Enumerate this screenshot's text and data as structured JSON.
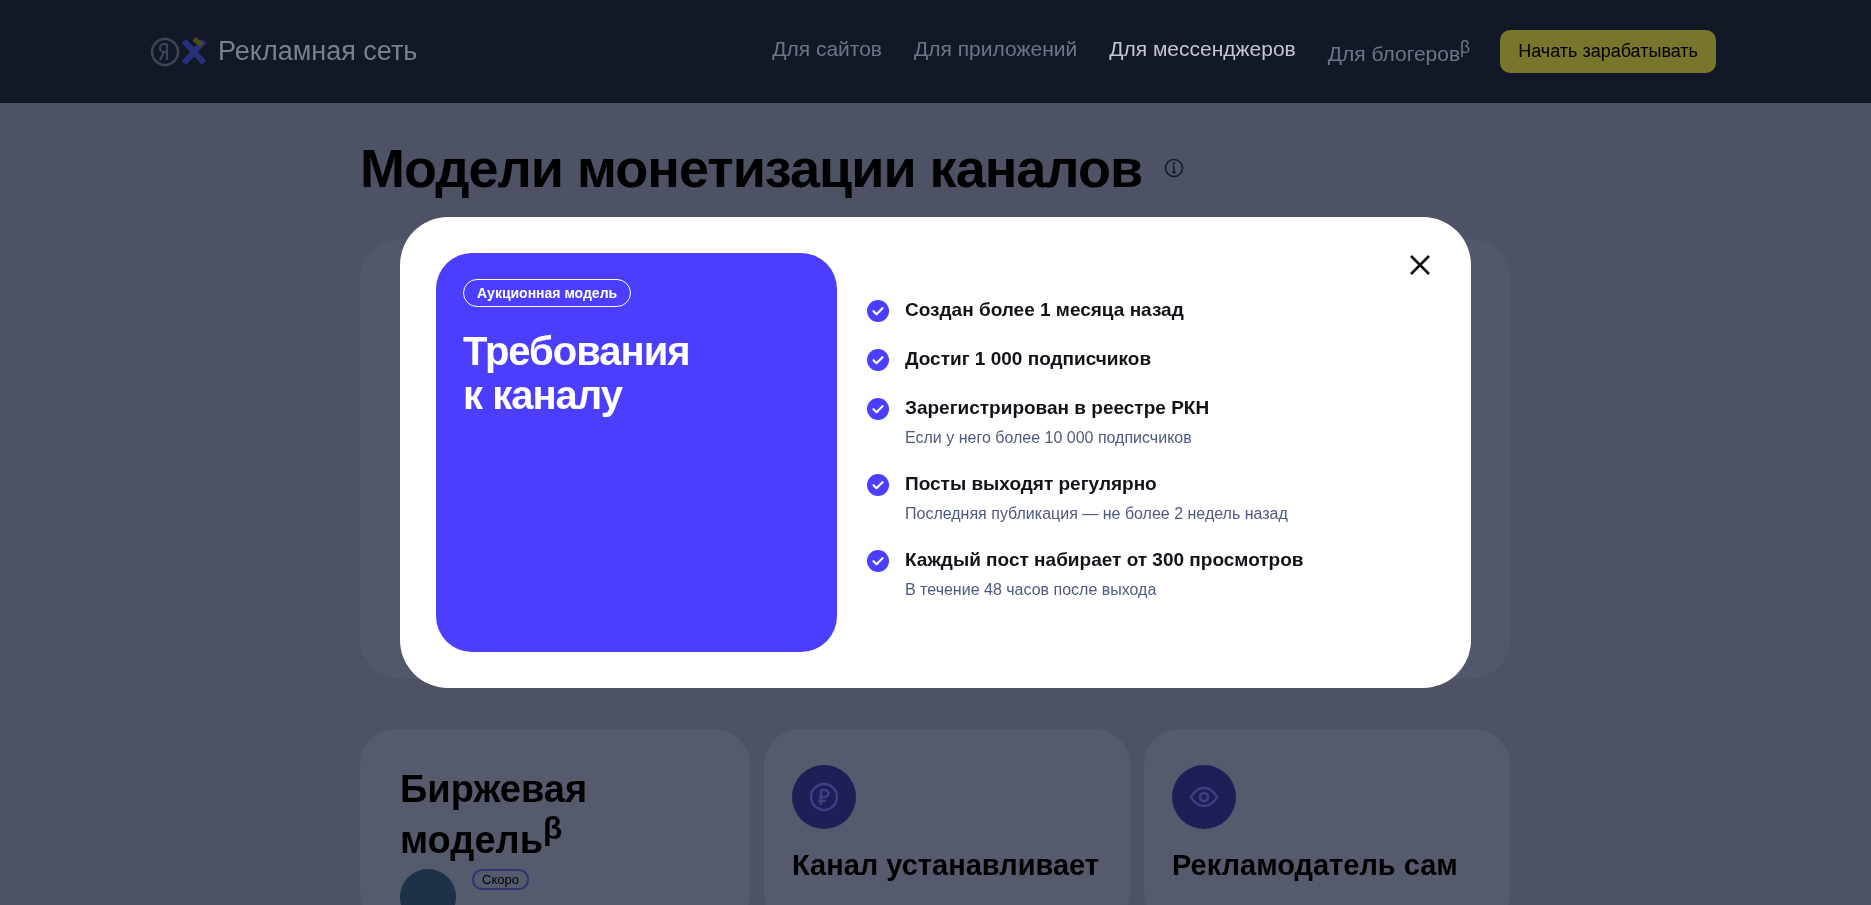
{
  "header": {
    "logo_text": "Рекламная сеть",
    "nav": [
      {
        "label": "Для сайтов",
        "selected": false
      },
      {
        "label": "Для приложений",
        "selected": false
      },
      {
        "label": "Для мессенджеров",
        "selected": true
      },
      {
        "label": "Для блогеров$^{β}$",
        "selected": false
      }
    ],
    "cta": "Начать зарабатывать"
  },
  "page": {
    "title": "Модели монетизации каналов",
    "cards": [
      {
        "kind": "title",
        "title": "Биржевая модель$^{β}$",
        "badge": "Скоро"
      },
      {
        "kind": "icon",
        "title": "Канал устанавливает"
      },
      {
        "kind": "icon",
        "title": "Рекламодатель сам"
      }
    ]
  },
  "modal": {
    "tag": "Аукционная модель",
    "title": "Требования к каналу",
    "requirements": [
      {
        "title": "Создан более 1 месяца назад"
      },
      {
        "title": "Достиг 1 000 подписчиков"
      },
      {
        "title": "Зарегистрирован в реестре РКН",
        "note": "Если у него более 10 000 подписчиков"
      },
      {
        "title": "Посты выходят регулярно",
        "note": "Последняя публикация — не более 2 недель назад"
      },
      {
        "title": "Каждый пост набирает от 300 просмотров",
        "note": "В течение 48 часов после выхода"
      }
    ]
  }
}
